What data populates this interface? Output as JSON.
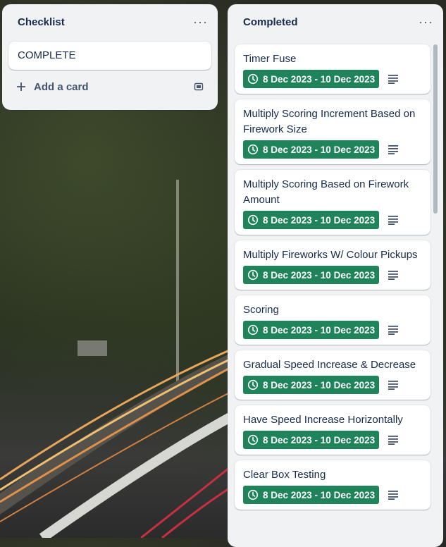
{
  "lists": {
    "checklist": {
      "title": "Checklist",
      "card_title": "COMPLETE",
      "add_card_label": "Add a card"
    },
    "completed": {
      "title": "Completed",
      "cards": [
        {
          "title": "Timer Fuse",
          "date": "8 Dec 2023 - 10 Dec 2023"
        },
        {
          "title": "Multiply Scoring Increment Based on Firework Size",
          "date": "8 Dec 2023 - 10 Dec 2023"
        },
        {
          "title": "Multiply Scoring Based on Firework Amount",
          "date": "8 Dec 2023 - 10 Dec 2023"
        },
        {
          "title": "Multiply Fireworks W/ Colour Pickups",
          "date": "8 Dec 2023 - 10 Dec 2023"
        },
        {
          "title": "Scoring",
          "date": "8 Dec 2023 - 10 Dec 2023"
        },
        {
          "title": "Gradual Speed Increase & Decrease",
          "date": "8 Dec 2023 - 10 Dec 2023"
        },
        {
          "title": "Have Speed Increase Horizontally",
          "date": "8 Dec 2023 - 10 Dec 2023"
        },
        {
          "title": "Clear Box Testing",
          "date": "8 Dec 2023 - 10 Dec 2023"
        }
      ]
    }
  },
  "icons": {
    "menu": "more-horizontal-icon",
    "add": "plus-icon",
    "template": "template-icon",
    "clock": "clock-icon",
    "description": "description-icon"
  },
  "colors": {
    "list_bg": "#f1f2f4",
    "date_badge": "#1f845a",
    "text": "#172b4d"
  }
}
